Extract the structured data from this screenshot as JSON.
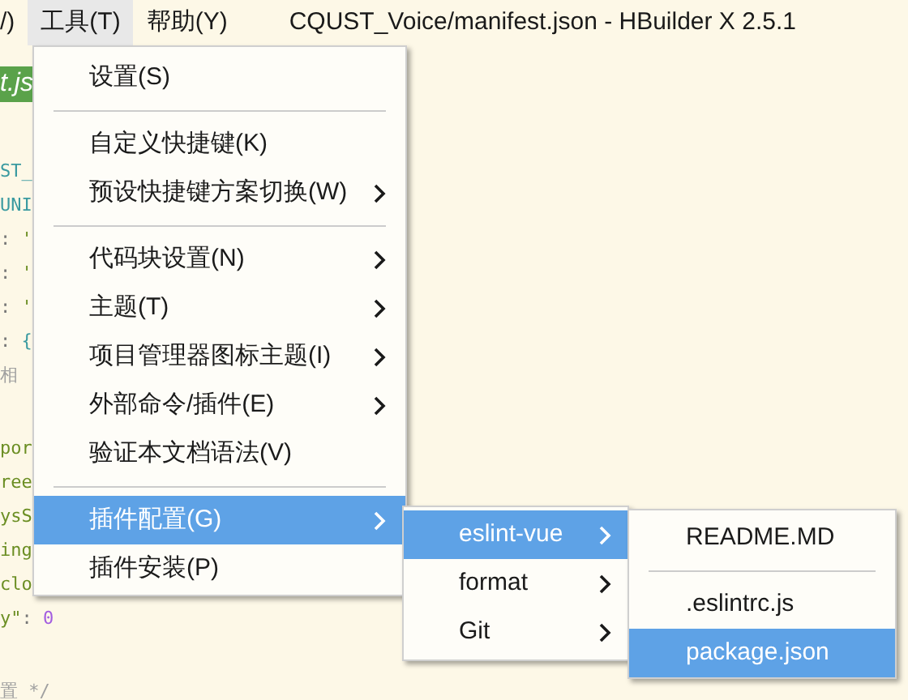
{
  "menubar": {
    "items": [
      {
        "label": "/)",
        "selected": false
      },
      {
        "label": "工具(T)",
        "selected": true
      },
      {
        "label": "帮助(Y)",
        "selected": false
      }
    ],
    "title": "CQUST_Voice/manifest.json - HBuilder X 2.5.1"
  },
  "editor": {
    "tab": "t.js",
    "code_blocks": [
      [
        [
          {
            "text": "ST_",
            "kind": "key"
          }
        ],
        [
          {
            "text": "UNI",
            "kind": "key"
          }
        ],
        [
          {
            "text": ": ",
            "kind": "punct"
          },
          {
            "text": "'",
            "kind": "string"
          }
        ],
        [
          {
            "text": ": ",
            "kind": "punct"
          },
          {
            "text": "'",
            "kind": "string"
          }
        ],
        [
          {
            "text": ": ",
            "kind": "punct"
          },
          {
            "text": "'",
            "kind": "string"
          }
        ],
        [
          {
            "text": ": ",
            "kind": "punct"
          },
          {
            "text": "{",
            "kind": "key"
          }
        ],
        [
          {
            "text": "相",
            "kind": "comment"
          }
        ]
      ],
      [
        [
          {
            "text": "por",
            "kind": "string"
          }
        ],
        [
          {
            "text": "ree",
            "kind": "string"
          }
        ],
        [
          {
            "text": "ysS",
            "kind": "string"
          }
        ],
        [
          {
            "text": "ing",
            "kind": "string"
          }
        ],
        [
          {
            "text": "clo",
            "kind": "string"
          }
        ],
        [
          {
            "text": "y\"",
            "kind": "string"
          },
          {
            "text": ": ",
            "kind": "punct"
          },
          {
            "text": "0",
            "kind": "number"
          }
        ]
      ],
      [
        [
          {
            "text": "置 */",
            "kind": "comment"
          }
        ]
      ]
    ]
  },
  "menu": {
    "items": [
      {
        "kind": "item",
        "label": "设置(S)",
        "has_submenu": false,
        "selected": false
      },
      {
        "kind": "separator"
      },
      {
        "kind": "item",
        "label": "自定义快捷键(K)",
        "has_submenu": false,
        "selected": false
      },
      {
        "kind": "item",
        "label": "预设快捷键方案切换(W)",
        "has_submenu": true,
        "selected": false
      },
      {
        "kind": "separator"
      },
      {
        "kind": "item",
        "label": "代码块设置(N)",
        "has_submenu": true,
        "selected": false
      },
      {
        "kind": "item",
        "label": "主题(T)",
        "has_submenu": true,
        "selected": false
      },
      {
        "kind": "item",
        "label": "项目管理器图标主题(I)",
        "has_submenu": true,
        "selected": false
      },
      {
        "kind": "item",
        "label": "外部命令/插件(E)",
        "has_submenu": true,
        "selected": false
      },
      {
        "kind": "item",
        "label": "验证本文档语法(V)",
        "has_submenu": false,
        "selected": false
      },
      {
        "kind": "separator"
      },
      {
        "kind": "item",
        "label": "插件配置(G)",
        "has_submenu": true,
        "selected": true
      },
      {
        "kind": "item",
        "label": "插件安装(P)",
        "has_submenu": false,
        "selected": false
      }
    ]
  },
  "submenu": {
    "items": [
      {
        "kind": "item",
        "label": "eslint-vue",
        "has_submenu": true,
        "selected": true
      },
      {
        "kind": "item",
        "label": "format",
        "has_submenu": true,
        "selected": false
      },
      {
        "kind": "item",
        "label": "Git",
        "has_submenu": true,
        "selected": false
      }
    ]
  },
  "file_menu": {
    "items": [
      {
        "kind": "item",
        "label": "README.MD",
        "has_submenu": false,
        "selected": false
      },
      {
        "kind": "separator"
      },
      {
        "kind": "item",
        "label": ".eslintrc.js",
        "has_submenu": false,
        "selected": false
      },
      {
        "kind": "item",
        "label": "package.json",
        "has_submenu": false,
        "selected": true
      }
    ]
  }
}
